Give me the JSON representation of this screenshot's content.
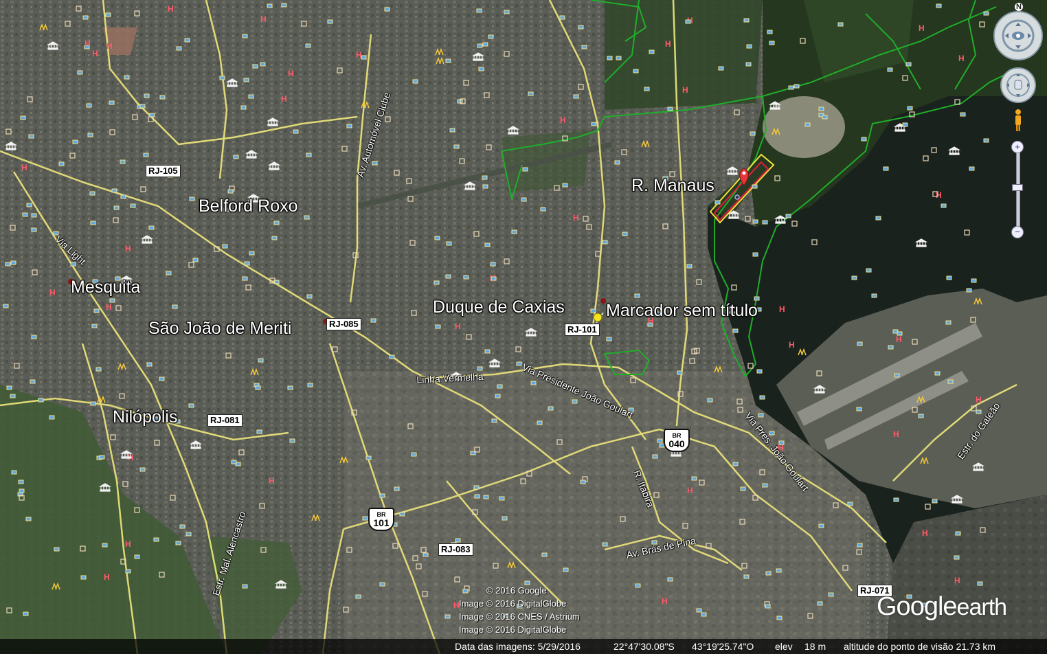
{
  "map": {
    "places": [
      {
        "name": "Belford Roxo",
        "key": "belford"
      },
      {
        "name": "Mesquita",
        "key": "mesquita"
      },
      {
        "name": "São João de Meriti",
        "key": "meriti"
      },
      {
        "name": "Nilópolis",
        "key": "nilopolis"
      },
      {
        "name": "Duque de Caxias",
        "key": "caxias"
      },
      {
        "name": "R. Manaus",
        "key": "manaus"
      },
      {
        "name": "Marcador sem título",
        "key": "marcador"
      }
    ],
    "roads": {
      "rj105": "RJ-105",
      "rj085": "RJ-085",
      "rj081": "RJ-081",
      "rj101": "RJ-101",
      "rj083": "RJ-083",
      "rj071": "RJ-071",
      "br040_t": "BR",
      "br040_n": "040",
      "br101_t": "BR",
      "br101_n": "101",
      "via_light": "Via Light",
      "av_automovel": "Av. Automóvel Clube",
      "linha_vermelha": "Linha Vermelha",
      "via_pres_joao_goulart": "Via Presidente João Goulart",
      "via_pres_joao_goulart2": "Via Pres. João Goulart",
      "estr_galeao": "Estr. do Galeão",
      "av_bras_pina": "Av. Brás de Pina",
      "r_itabira": "R. Itabira",
      "estr_mal_alencastro": "Estr. Mal. Alencastro"
    },
    "credits": [
      "© 2016 Google",
      "Image © 2016 DigitalGlobe",
      "Image © 2016 CNES / Astrium",
      "Image © 2016 DigitalGlobe"
    ],
    "logo": {
      "brand": "Google",
      "suffix": "earth"
    }
  },
  "status_bar": {
    "imagery_date": "Data das imagens: 5/29/2016",
    "lat": "22°47'30.08\"S",
    "lon": "43°19'25.74\"O",
    "elev_label": "elev",
    "elev_value": "18 m",
    "eye_alt": "altitude do ponto de visão  21.73 km"
  },
  "controls": {
    "north": "N",
    "zoom_in": "+",
    "zoom_out": "−"
  },
  "colors": {
    "road": "#e8e07a",
    "boundary": "#1fae2a",
    "polygon_outline": "#e0203a",
    "polygon_outer": "#f0e23c"
  }
}
